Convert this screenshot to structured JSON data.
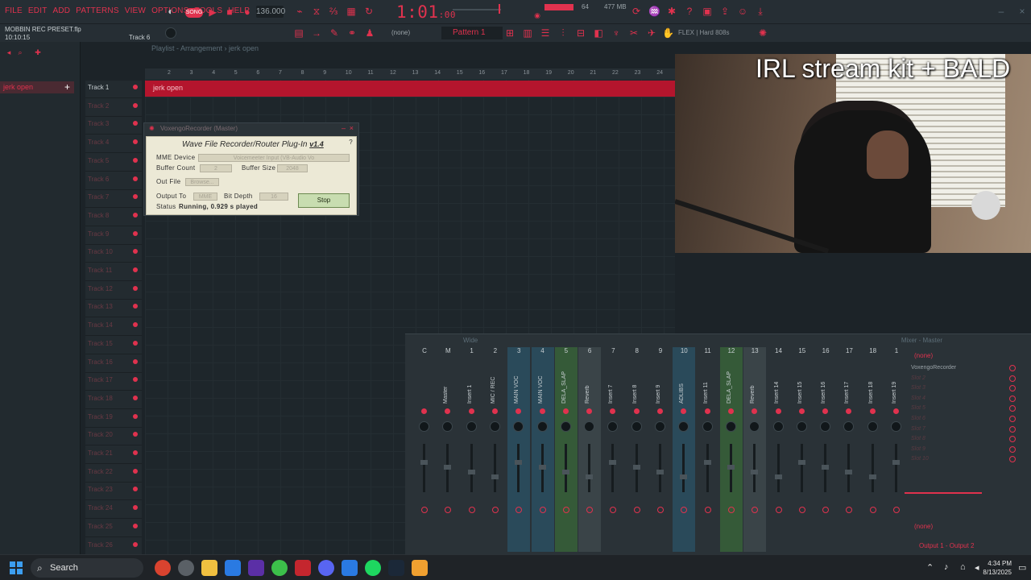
{
  "menu": [
    "FILE",
    "EDIT",
    "ADD",
    "PATTERNS",
    "VIEW",
    "OPTIONS",
    "TOOLS",
    "HELP"
  ],
  "transport": {
    "song_label": "SONG",
    "bpm": "136.000",
    "clock_main": "1:01",
    "clock_sub": "00",
    "cpu_value": "64",
    "mem_value": "477 MB"
  },
  "hint": {
    "file": "MOBBIN REC PRESET.flp",
    "time": "10:10:15",
    "track": "Track 6"
  },
  "toolbar2": {
    "snap": "(none)",
    "pattern": "Pattern 1",
    "flex": "FLEX | Hard 808s"
  },
  "browser": {
    "item": "jerk open"
  },
  "playlist": {
    "title": "Playlist - Arrangement › jerk open",
    "ruler": [
      "2",
      "3",
      "4",
      "5",
      "6",
      "7",
      "8",
      "9",
      "10",
      "11",
      "12",
      "13",
      "14",
      "15",
      "16",
      "17",
      "18",
      "19",
      "20",
      "21",
      "22",
      "23",
      "24"
    ],
    "clip_label": "jerk open",
    "tracks": [
      "Track 1",
      "Track 2",
      "Track 3",
      "Track 4",
      "Track 5",
      "Track 6",
      "Track 7",
      "Track 8",
      "Track 9",
      "Track 10",
      "Track 11",
      "Track 12",
      "Track 13",
      "Track 14",
      "Track 15",
      "Track 16",
      "Track 17",
      "Track 18",
      "Track 19",
      "Track 20",
      "Track 21",
      "Track 22",
      "Track 23",
      "Track 24",
      "Track 25",
      "Track 26"
    ]
  },
  "plugin": {
    "window_title": "VoxengoRecorder (Master)",
    "heading": "Wave File Recorder/Router Plug-In",
    "version": "v1.4",
    "help": "?",
    "mme_label": "MME Device",
    "mme_value": "Voicemeeter Input (VB-Audio Vo",
    "buffer_count_label": "Buffer Count",
    "buffer_count_value": "2",
    "buffer_size_label": "Buffer Size",
    "buffer_size_value": "2048",
    "out_file_label": "Out File",
    "browse_label": "Browse...",
    "output_to_label": "Output To",
    "output_to_value": "MME",
    "bit_depth_label": "Bit Depth",
    "bit_depth_value": "16",
    "status_label": "Status",
    "status_value": "Running, 0.929 s played",
    "stop_label": "Stop"
  },
  "stream": {
    "title": "IRL stream kit + BALD"
  },
  "mixer": {
    "title": "Mixer - Master",
    "wide": "Wide",
    "channels": [
      {
        "num": "C",
        "name": ""
      },
      {
        "num": "M",
        "name": "Master"
      },
      {
        "num": "1",
        "name": "Insert 1"
      },
      {
        "num": "2",
        "name": "MIC / REC"
      },
      {
        "num": "3",
        "name": "MAIN VOC"
      },
      {
        "num": "4",
        "name": "MAIN VOC"
      },
      {
        "num": "5",
        "name": "DELA_SLAP"
      },
      {
        "num": "6",
        "name": "Reverb"
      },
      {
        "num": "7",
        "name": "Insert 7"
      },
      {
        "num": "8",
        "name": "Insert 8"
      },
      {
        "num": "9",
        "name": "Insert 9"
      },
      {
        "num": "10",
        "name": "ADLIBS"
      },
      {
        "num": "11",
        "name": "Insert 11"
      },
      {
        "num": "12",
        "name": "DELA_SLAP"
      },
      {
        "num": "13",
        "name": "Reverb"
      },
      {
        "num": "14",
        "name": "Insert 14"
      },
      {
        "num": "15",
        "name": "Insert 15"
      },
      {
        "num": "16",
        "name": "Insert 16"
      },
      {
        "num": "17",
        "name": "Insert 17"
      },
      {
        "num": "18",
        "name": "Insert 18"
      },
      {
        "num": "1",
        "name": "Insert 19"
      }
    ],
    "slot_none_top": "(none)",
    "slots": [
      "VoxengoRecorder",
      "Slot 2",
      "Slot 3",
      "Slot 4",
      "Slot 5",
      "Slot 6",
      "Slot 7",
      "Slot 8",
      "Slot 9",
      "Slot 10"
    ],
    "slot_none_bottom": "(none)",
    "output": "Output 1 - Output 2"
  },
  "taskbar": {
    "search": "Search",
    "time": "4:34 PM",
    "date": "8/13/2025"
  },
  "colors": {
    "accent": "#e0324e",
    "bg": "#1c2328",
    "clip": "#b4152d"
  }
}
